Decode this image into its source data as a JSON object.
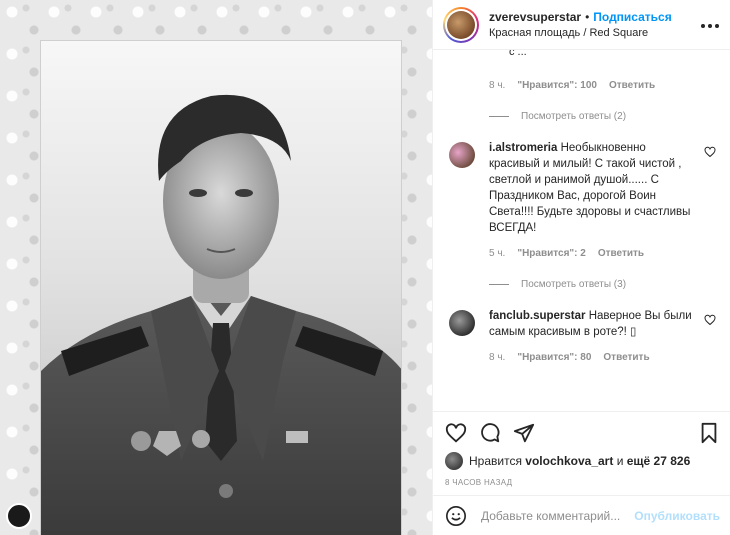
{
  "post": {
    "username": "zverevsuperstar",
    "separator": "•",
    "follow_label": "Подписаться",
    "location": "Красная площадь / Red Square",
    "more_icon": "more-icon"
  },
  "thread": {
    "top_cut_text": "с ...",
    "top_meta": {
      "time": "8 ч.",
      "likes": "\"Нравится\": 100",
      "reply": "Ответить"
    },
    "top_replies": "Посмотреть ответы (2)"
  },
  "comments": [
    {
      "user": "i.alstromeria",
      "text": "Необыкновенно красивый и милый! С такой чистой , светлой и ранимой душой...... С Праздником Вас, дорогой Воин Света!!!! Будьте здоровы и счастливы ВСЕГДА!",
      "time": "5 ч.",
      "likes": "\"Нравится\": 2",
      "reply": "Ответить",
      "replies": "Посмотреть ответы (3)"
    },
    {
      "user": "fanclub.superstar",
      "text": "Наверное Вы были самым красивым в роте?! ▯",
      "time": "8 ч.",
      "likes": "\"Нравится\": 80",
      "reply": "Ответить"
    }
  ],
  "footer": {
    "liked_prefix": "Нравится",
    "liked_user": "volochkova_art",
    "liked_middle": "и",
    "liked_count": "ещё 27 826",
    "timestamp": "8 ЧАСОВ НАЗАД",
    "comment_placeholder": "Добавьте комментарий...",
    "publish_label": "Опубликовать"
  },
  "colors": {
    "accent": "#0095f6",
    "publish_disabled": "#b2dffc",
    "muted": "#8e8e8e"
  }
}
